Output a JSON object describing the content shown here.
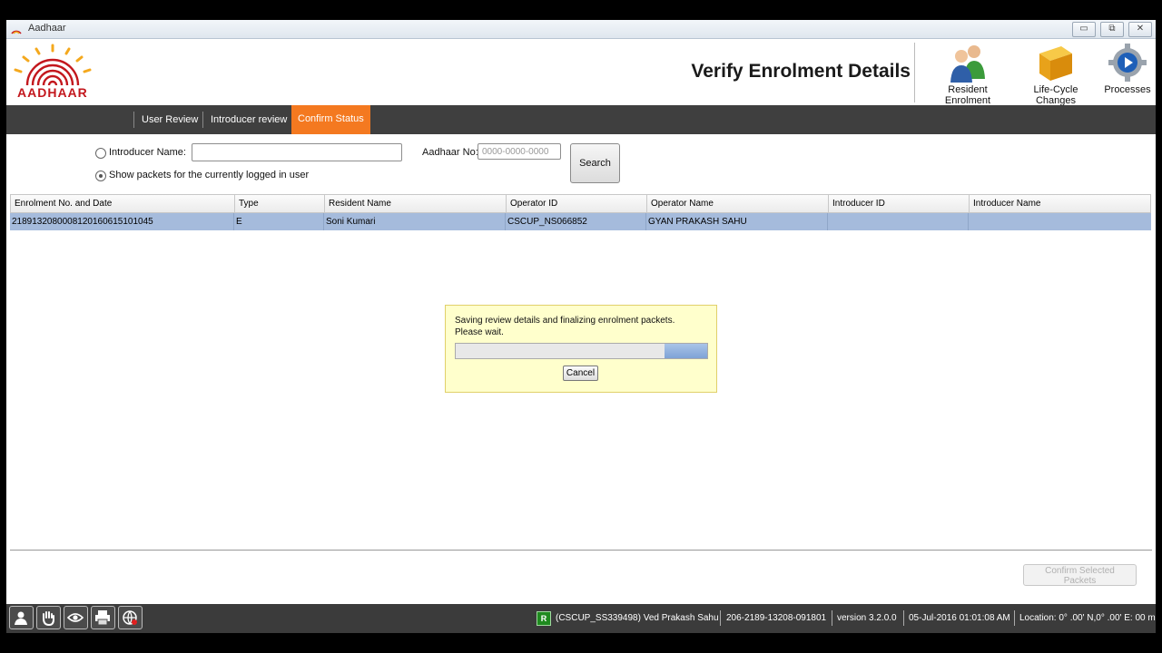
{
  "window": {
    "title": "Aadhaar",
    "controls": [
      "▭",
      "⧉",
      "✕"
    ]
  },
  "header": {
    "logo_text": "AADHAAR",
    "page_title": "Verify Enrolment Details",
    "tools": [
      {
        "label": "Resident Enrolment",
        "icon": "people-icon"
      },
      {
        "label": "Life-Cycle Changes",
        "icon": "box-icon"
      },
      {
        "label": "Processes",
        "icon": "gear-icon"
      }
    ]
  },
  "nav": {
    "tabs": [
      "User Review",
      "Introducer review",
      "Confirm Status"
    ],
    "active": "Confirm Status"
  },
  "filter": {
    "introducer_label": "Introducer Name:",
    "show_packets_label": "Show packets for the currently logged in user",
    "aadhaar_label": "Aadhaar No:",
    "aadhaar_placeholder": "0000-0000-0000",
    "introducer_value": "",
    "search_label": "Search"
  },
  "table": {
    "columns": [
      "Enrolment No. and Date",
      "Type",
      "Resident Name",
      "Operator ID",
      "Operator Name",
      "Introducer ID",
      "Introducer Name"
    ],
    "rows": [
      [
        "21891320800081201606151 01045",
        "E",
        "Soni Kumari",
        "CSCUP_NS066852",
        "GYAN PRAKASH SAHU",
        "",
        ""
      ]
    ]
  },
  "dialog": {
    "message_line1": "Saving review details and finalizing enrolment packets.",
    "message_line2": "Please wait.",
    "progress": 0.17,
    "cancel_label": "Cancel"
  },
  "confirm_label": "Confirm Selected Packets",
  "status": {
    "indicator": "R",
    "user": "(CSCUP_SS339498) Ved Prakash Sahu",
    "station": "206-2189-13208-091801",
    "version": "version 3.2.0.0",
    "datetime": "05-Jul-2016 01:01:08 AM",
    "location": "Location: 0° .00' N,0° .00' E: 00 m"
  },
  "colors": {
    "nav_active": "#f47920",
    "row_selected": "#a5bbdc",
    "dialog_bg": "#ffffcc"
  }
}
